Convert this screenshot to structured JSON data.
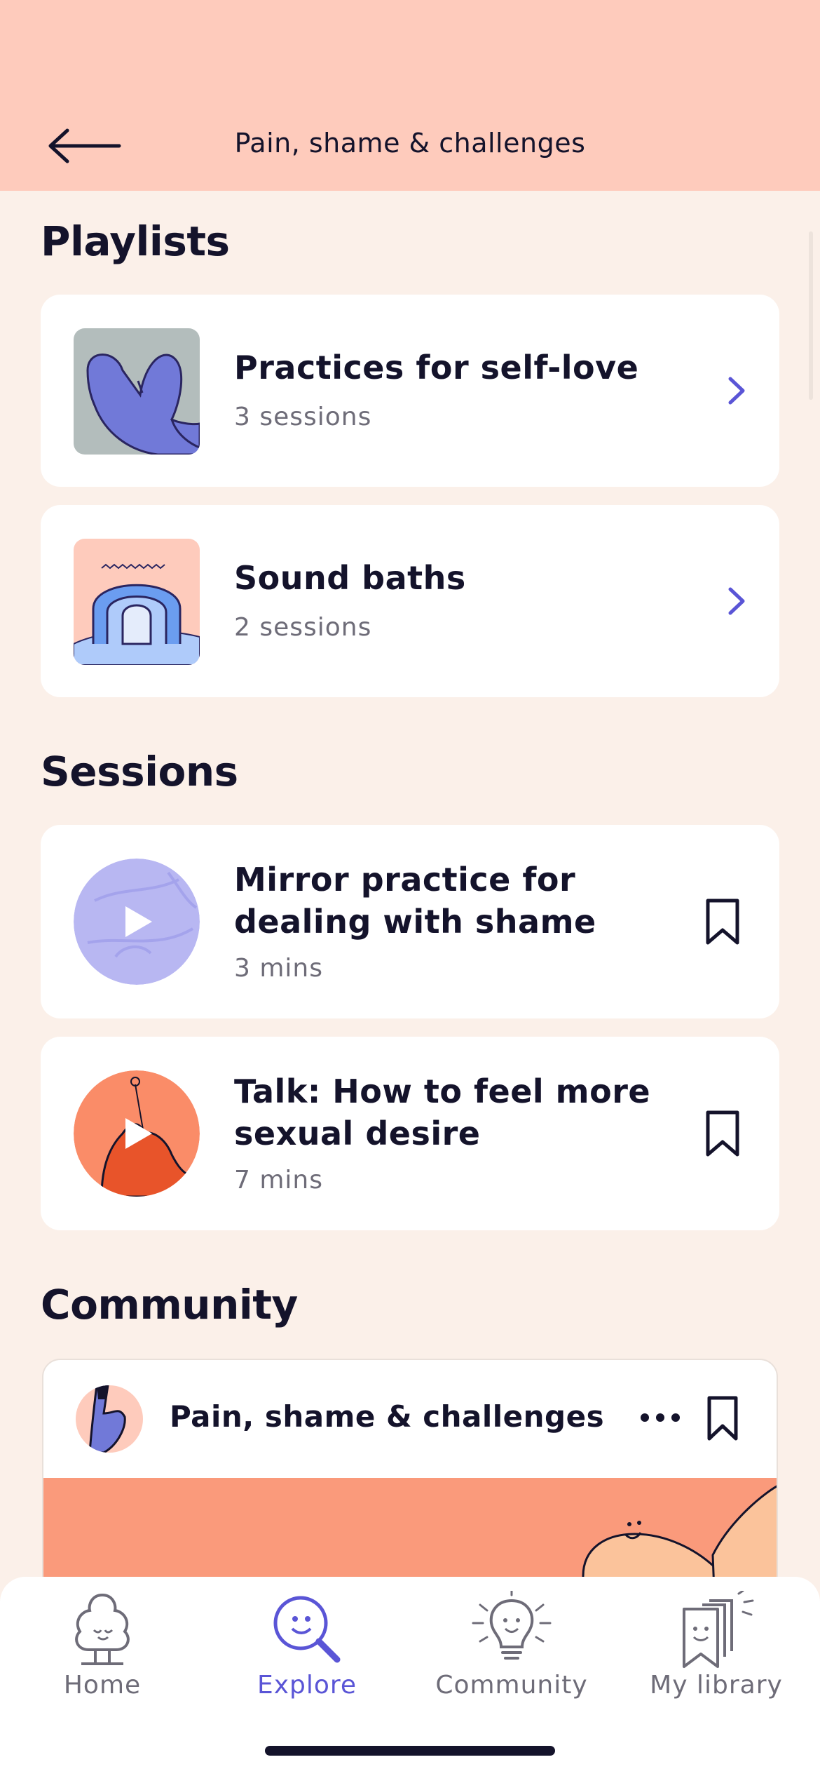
{
  "header": {
    "title": "Pain, shame & challenges",
    "back_icon": "arrow-left-icon"
  },
  "playlists": {
    "heading": "Playlists",
    "items": [
      {
        "title": "Practices for self-love",
        "subtitle": "3 sessions",
        "thumb_color": "#B3BDBC"
      },
      {
        "title": "Sound baths",
        "subtitle": "2 sessions",
        "thumb_color": "#FECBBC"
      }
    ]
  },
  "sessions": {
    "heading": "Sessions",
    "items": [
      {
        "title_line1": "Mirror practice for",
        "title_line2": "dealing with shame",
        "duration": "3 mins",
        "thumb_color": "#B8B7F2"
      },
      {
        "title_line1": "Talk: How to feel more",
        "title_line2": "sexual desire",
        "duration": "7 mins",
        "thumb_color": "#FA8C68"
      }
    ]
  },
  "community": {
    "heading": "Community",
    "post": {
      "title": "Pain, shame & challenges"
    }
  },
  "tabbar": {
    "items": [
      {
        "label": "Home",
        "icon": "tree-icon"
      },
      {
        "label": "Explore",
        "icon": "search-face-icon"
      },
      {
        "label": "Community",
        "icon": "lightbulb-icon"
      },
      {
        "label": "My library",
        "icon": "bookmark-stack-icon"
      }
    ],
    "active": "Explore"
  },
  "colors": {
    "background": "#FBF0E9",
    "header": "#FECBBC",
    "accent": "#5A55D6",
    "text": "#14132B",
    "muted": "#6E6C78"
  }
}
